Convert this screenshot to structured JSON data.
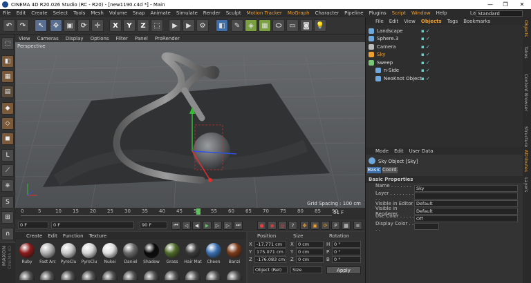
{
  "window": {
    "title": "CINEMA 4D R20.026 Studio (RC - R20) - [new1190.c4d *] - Main",
    "minimize": "—",
    "maximize": "❐",
    "close": "✕"
  },
  "menubar": {
    "items": [
      "File",
      "Edit",
      "Create",
      "Select",
      "Tools",
      "Mesh",
      "Volume",
      "Snap",
      "Animate",
      "Simulate",
      "Render",
      "Sculpt",
      "Motion Tracker",
      "MoGraph",
      "Character",
      "Pipeline",
      "Plugins",
      "Script",
      "Window",
      "Help"
    ],
    "layout_label": "Layout:",
    "layout_value": "Standard"
  },
  "viewport_menu": {
    "items": [
      "View",
      "Cameras",
      "Display",
      "Options",
      "Filter",
      "Panel",
      "ProRender"
    ]
  },
  "viewport": {
    "label": "Perspective",
    "grid_spacing": "Grid Spacing : 100 cm"
  },
  "timeline": {
    "ticks": [
      "0",
      "5",
      "10",
      "15",
      "20",
      "25",
      "30",
      "35",
      "40",
      "45",
      "50",
      "55",
      "60",
      "65",
      "70",
      "75",
      "80",
      "85",
      "90"
    ],
    "current_frame": "51",
    "end_label": "51 F"
  },
  "playbar": {
    "start": "0 F",
    "min": "0 F",
    "max": "90 F",
    "end": "90 F"
  },
  "materials": {
    "menu": [
      "Create",
      "Edit",
      "Function",
      "Texture"
    ],
    "items": [
      {
        "name": "Ruby",
        "color": "#8b1a1a"
      },
      {
        "name": "Fast Arc",
        "color": "#b0b0b0"
      },
      {
        "name": "PyroClu",
        "color": "#c8c8c8"
      },
      {
        "name": "PyroClu",
        "color": "#d6d6d6"
      },
      {
        "name": "Nukei",
        "color": "#e0e0e0"
      },
      {
        "name": "Daniel",
        "color": "#6a6a6a"
      },
      {
        "name": "Shadow",
        "color": "#0a0a0a"
      },
      {
        "name": "Grass",
        "color": "#4f6a2a"
      },
      {
        "name": "Hair Mat",
        "color": "#3a3a3a"
      },
      {
        "name": "Cheen",
        "color": "#3a6fb0"
      },
      {
        "name": "Banzi",
        "color": "#7a3a1a"
      }
    ]
  },
  "coords": {
    "headers": [
      "Position",
      "Size",
      "Rotation"
    ],
    "rows": [
      {
        "axis": "X",
        "pos": "-17.771 cm",
        "size_axis": "X",
        "size": "0 cm",
        "rot_axis": "H",
        "rot": "0 °"
      },
      {
        "axis": "Y",
        "pos": "175.071 cm",
        "size_axis": "Y",
        "size": "0 cm",
        "rot_axis": "P",
        "rot": "0 °"
      },
      {
        "axis": "Z",
        "pos": "-176.083 cm",
        "size_axis": "Z",
        "size": "0 cm",
        "rot_axis": "B",
        "rot": "0 °"
      }
    ],
    "mode": "Object (Rel)",
    "size_mode": "Size",
    "apply": "Apply"
  },
  "objects": {
    "tabs": [
      "File",
      "Edit",
      "View",
      "Objects",
      "Tags",
      "Bookmarks"
    ],
    "active_tab": "Objects",
    "items": [
      {
        "name": "Landscape",
        "indent": 0,
        "color": "#6fa8dc"
      },
      {
        "name": "Sphere.3",
        "indent": 0,
        "color": "#6fa8dc"
      },
      {
        "name": "Camera",
        "indent": 0,
        "color": "#bbbbbb"
      },
      {
        "name": "Sky",
        "indent": 0,
        "color": "#f0a030"
      },
      {
        "name": "Sweep",
        "indent": 0,
        "color": "#7ac77a"
      },
      {
        "name": "n-Side",
        "indent": 1,
        "color": "#6fa8dc"
      },
      {
        "name": "NeoKnot Object",
        "indent": 1,
        "color": "#6fa8dc"
      }
    ]
  },
  "attributes": {
    "menu": [
      "Mode",
      "Edit",
      "User Data"
    ],
    "object_title": "Sky Object [Sky]",
    "tabs": [
      "Basic",
      "Coord."
    ],
    "section": "Basic Properties",
    "props": [
      {
        "label": "Name . . . . . . . . . .",
        "value": "Sky"
      },
      {
        "label": "Layer . . . . . . . . . .",
        "value": ""
      },
      {
        "label": "Visible in Editor",
        "value": "Default"
      },
      {
        "label": "Visible in Renderer",
        "value": "Default"
      },
      {
        "label": "Use Color . . . . . .",
        "value": "Off"
      },
      {
        "label": "Display Color . . . .",
        "value": ""
      }
    ]
  },
  "sidetabs": [
    "Objects",
    "Takes",
    "Content Browser",
    "Structure",
    "Attributes",
    "Layers"
  ],
  "brand": {
    "line1": "MAXON",
    "line2": "CINEMA 4D"
  },
  "colors": {
    "accent": "#f0a030",
    "panel": "#333333",
    "viewport": "#5a5d60"
  }
}
